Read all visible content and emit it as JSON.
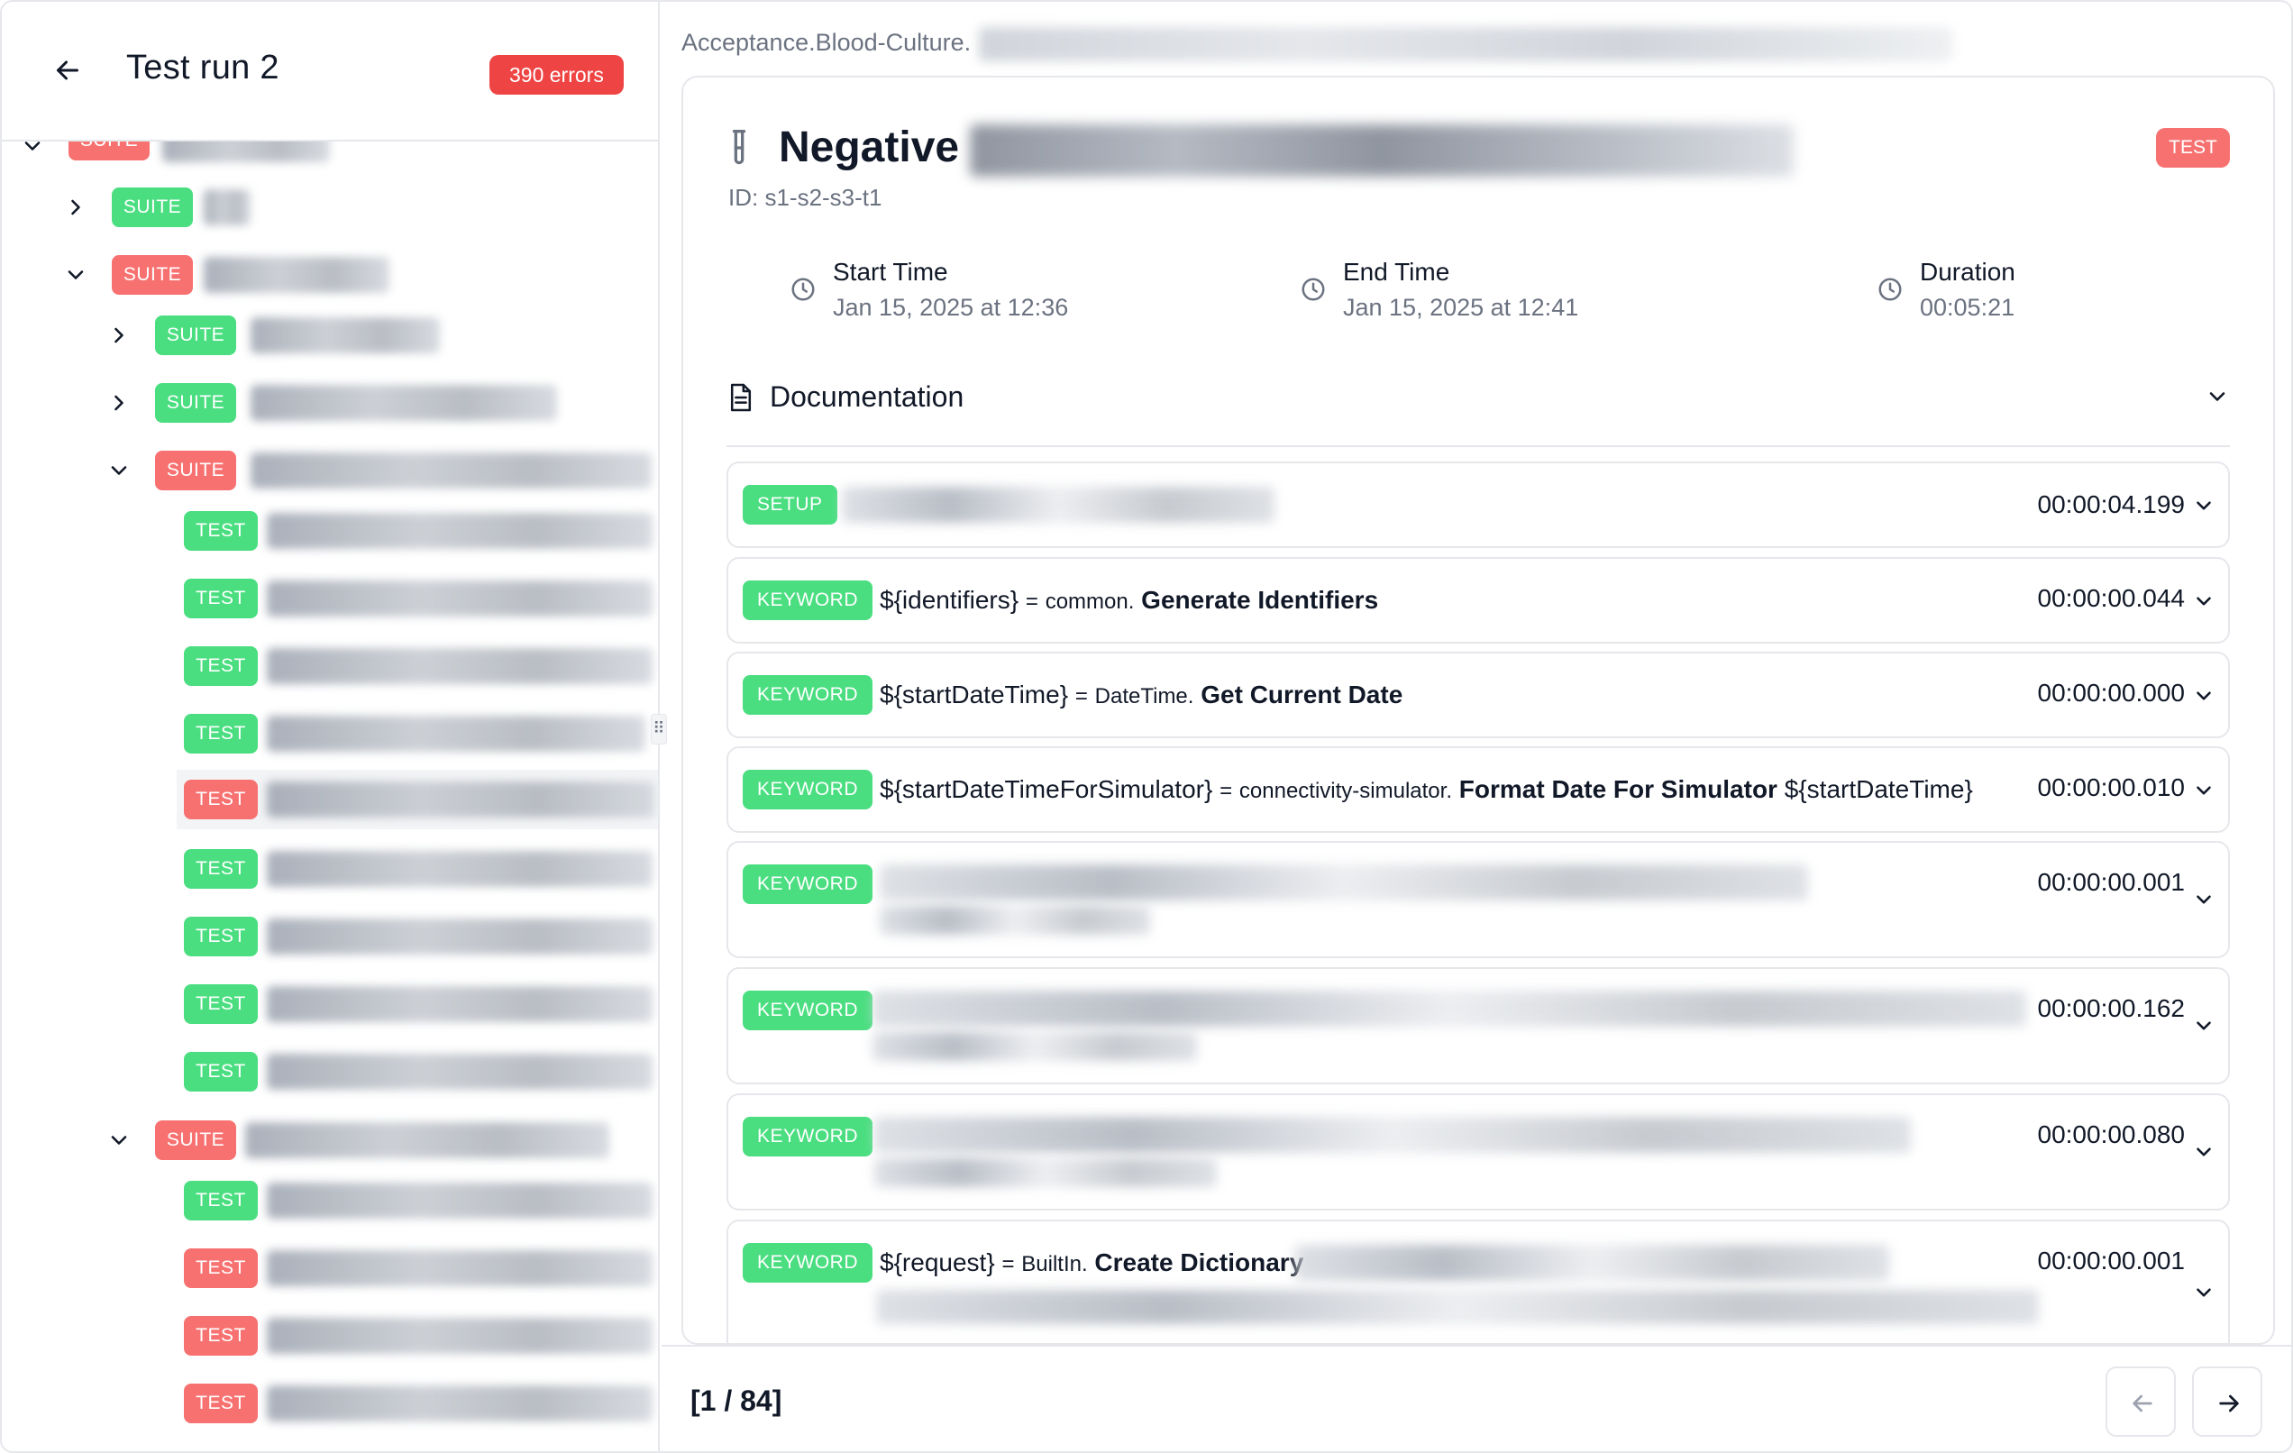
{
  "sidebar": {
    "title": "Test run 2",
    "errors_badge": "390 errors",
    "suite_label": "SUITE",
    "test_label": "TEST",
    "rows": [
      {
        "kind": "SUITE",
        "status": "red"
      },
      {
        "kind": "SUITE",
        "status": "green",
        "chevron": "chevron-right"
      },
      {
        "kind": "SUITE",
        "status": "red",
        "chevron": "chevron-down"
      },
      {
        "kind": "SUITE",
        "status": "green",
        "chevron": "chevron-right"
      },
      {
        "kind": "SUITE",
        "status": "green",
        "chevron": "chevron-right"
      },
      {
        "kind": "SUITE",
        "status": "red",
        "chevron": "chevron-down"
      },
      {
        "kind": "TEST",
        "status": "green"
      },
      {
        "kind": "TEST",
        "status": "green"
      },
      {
        "kind": "TEST",
        "status": "green"
      },
      {
        "kind": "TEST",
        "status": "green"
      },
      {
        "kind": "TEST",
        "status": "red",
        "selected": true
      },
      {
        "kind": "TEST",
        "status": "green"
      },
      {
        "kind": "TEST",
        "status": "green"
      },
      {
        "kind": "TEST",
        "status": "green"
      },
      {
        "kind": "TEST",
        "status": "green"
      },
      {
        "kind": "SUITE",
        "status": "red",
        "chevron": "chevron-down"
      },
      {
        "kind": "TEST",
        "status": "green"
      },
      {
        "kind": "TEST",
        "status": "red"
      },
      {
        "kind": "TEST",
        "status": "red"
      },
      {
        "kind": "TEST",
        "status": "red"
      }
    ]
  },
  "detail": {
    "breadcrumb": "Acceptance.Blood-Culture.",
    "test_name": "Negative",
    "type_badge": "TEST",
    "test_id": "ID: s1-s2-s3-t1",
    "start_time": {
      "label": "Start Time",
      "value": "Jan 15, 2025 at 12:36"
    },
    "end_time": {
      "label": "End Time",
      "value": "Jan 15, 2025 at 12:41"
    },
    "duration": {
      "label": "Duration",
      "value": "00:05:21"
    },
    "documentation_label": "Documentation",
    "steps": [
      {
        "badge": "SETUP",
        "duration": "00:00:04.199"
      },
      {
        "badge": "KEYWORD",
        "var": "${identifiers}",
        "eq": "=",
        "lib": "common.",
        "keyword": "Generate Identifiers",
        "args": "",
        "duration": "00:00:00.044"
      },
      {
        "badge": "KEYWORD",
        "var": "${startDateTime}",
        "eq": "=",
        "lib": "DateTime.",
        "keyword": "Get Current Date",
        "args": "",
        "duration": "00:00:00.000"
      },
      {
        "badge": "KEYWORD",
        "var": "${startDateTimeForSimulator}",
        "eq": "=",
        "lib": "connectivity-simulator.",
        "keyword": "Format Date For Simulator",
        "args": "${startDateTime}",
        "duration": "00:00:00.010"
      },
      {
        "badge": "KEYWORD",
        "duration": "00:00:00.001"
      },
      {
        "badge": "KEYWORD",
        "duration": "00:00:00.162"
      },
      {
        "badge": "KEYWORD",
        "duration": "00:00:00.080"
      },
      {
        "badge": "KEYWORD",
        "var": "${request}",
        "eq": "=",
        "lib": "BuiltIn.",
        "keyword": "Create Dictionary",
        "args": "",
        "duration": "00:00:00.001"
      }
    ]
  },
  "footer": {
    "page_counter": "[1 / 84]"
  },
  "colors": {
    "pass": "#4ade80",
    "fail": "#f87171",
    "error_badge": "#ef4444",
    "border": "#e5e7eb",
    "muted_text": "#6b7280"
  },
  "icons": [
    "arrow-left-icon",
    "chevron-right-icon",
    "chevron-down-icon",
    "flask-icon",
    "clock-icon",
    "document-icon",
    "arrow-right-icon"
  ]
}
